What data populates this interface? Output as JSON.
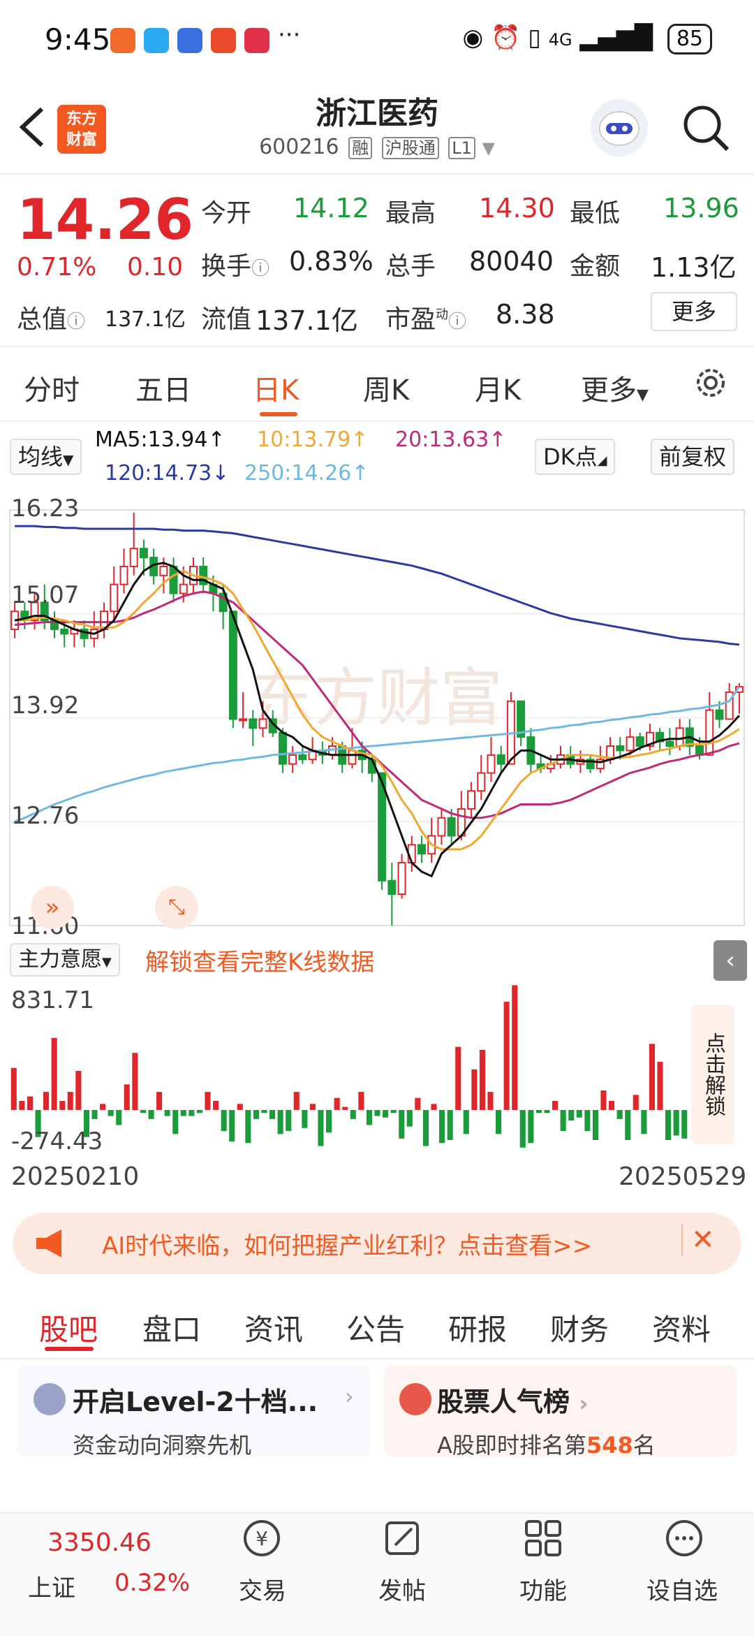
{
  "status_bar": {
    "time": "9:45",
    "network": "4G",
    "battery": "85"
  },
  "header": {
    "back_icon": "back-arrow-icon",
    "logo_text_1": "东方",
    "logo_text_2": "财富",
    "title": "浙江医药",
    "code": "600216",
    "tag_rong": "融",
    "tag_hgt": "沪股通",
    "tag_l1": "L1",
    "search_icon": "search-icon"
  },
  "quote": {
    "price": "14.26",
    "pct": "0.71%",
    "change": "0.10",
    "open_label": "今开",
    "open": "14.12",
    "high_label": "最高",
    "high": "14.30",
    "low_label": "最低",
    "low": "13.96",
    "turnover_label": "换手",
    "turnover": "0.83%",
    "volume_label": "总手",
    "volume": "80040",
    "amount_label": "金额",
    "amount": "1.13亿",
    "mktcap_label": "总值",
    "mktcap": "137.1亿",
    "float_label": "流值",
    "float": "137.1亿",
    "pe_label": "市盈",
    "pe_sup": "动",
    "pe": "8.38",
    "more": "更多"
  },
  "periods": [
    "分时",
    "五日",
    "日K",
    "周K",
    "月K",
    "更多"
  ],
  "active_period": "日K",
  "chart_controls": {
    "ma_select": "均线",
    "dk": "DK点",
    "fq": "前复权"
  },
  "ma_labels": {
    "ma5": "MA5:13.94↑",
    "ma10": "10:13.79↑",
    "ma20": "20:13.63↑",
    "ma120": "120:14.73↓",
    "ma250": "250:14.26↑"
  },
  "colors": {
    "accent": "#f25a22",
    "up": "#e0262a",
    "down": "#1a9c3a",
    "ma5": "#111111",
    "ma10": "#f0a830",
    "ma20": "#c0287a",
    "ma120": "#2a3aa0",
    "ma250": "#6fb8e0"
  },
  "chart_data": [
    {
      "type": "candlestick",
      "ylim": [
        11.6,
        16.23
      ],
      "y_ticks": [
        "16.23",
        "15.07",
        "13.92",
        "12.76",
        "11.60"
      ],
      "x_range": [
        "20250210",
        "20250529"
      ],
      "watermark": "东方财富",
      "candles": [
        [
          14.9,
          15.1,
          15.2,
          14.8
        ],
        [
          15.1,
          15.0,
          15.2,
          14.9
        ],
        [
          15.0,
          15.2,
          15.3,
          14.9
        ],
        [
          15.2,
          15.0,
          15.4,
          14.9
        ],
        [
          15.0,
          14.9,
          15.1,
          14.8
        ],
        [
          14.9,
          14.85,
          15.0,
          14.7
        ],
        [
          14.85,
          14.9,
          15.0,
          14.7
        ],
        [
          14.9,
          14.8,
          15.0,
          14.7
        ],
        [
          14.8,
          14.9,
          15.1,
          14.7
        ],
        [
          14.9,
          15.1,
          15.2,
          14.8
        ],
        [
          15.1,
          15.4,
          15.6,
          15.0
        ],
        [
          15.4,
          15.6,
          15.8,
          15.3
        ],
        [
          15.6,
          15.8,
          16.2,
          15.5
        ],
        [
          15.8,
          15.7,
          15.9,
          15.5
        ],
        [
          15.7,
          15.5,
          15.8,
          15.4
        ],
        [
          15.5,
          15.6,
          15.7,
          15.3
        ],
        [
          15.6,
          15.3,
          15.7,
          15.2
        ],
        [
          15.3,
          15.4,
          15.6,
          15.2
        ],
        [
          15.4,
          15.6,
          15.7,
          15.3
        ],
        [
          15.6,
          15.4,
          15.7,
          15.3
        ],
        [
          15.4,
          15.3,
          15.5,
          15.1
        ],
        [
          15.3,
          15.1,
          15.4,
          14.9
        ],
        [
          15.1,
          13.9,
          15.1,
          13.8
        ],
        [
          13.9,
          13.9,
          14.2,
          13.8
        ],
        [
          13.9,
          13.8,
          14.0,
          13.6
        ],
        [
          13.8,
          13.9,
          14.1,
          13.7
        ],
        [
          13.9,
          13.75,
          14.0,
          13.7
        ],
        [
          13.75,
          13.4,
          13.8,
          13.3
        ],
        [
          13.4,
          13.5,
          13.6,
          13.3
        ],
        [
          13.5,
          13.45,
          13.6,
          13.4
        ],
        [
          13.45,
          13.55,
          13.7,
          13.4
        ],
        [
          13.55,
          13.5,
          13.65,
          13.4
        ],
        [
          13.5,
          13.6,
          13.7,
          13.45
        ],
        [
          13.6,
          13.4,
          13.65,
          13.3
        ],
        [
          13.4,
          13.55,
          13.8,
          13.35
        ],
        [
          13.55,
          13.45,
          13.65,
          13.3
        ],
        [
          13.45,
          13.3,
          13.5,
          13.2
        ],
        [
          13.3,
          12.1,
          13.3,
          12.0
        ],
        [
          12.1,
          11.95,
          12.3,
          11.6
        ],
        [
          11.95,
          12.3,
          12.4,
          11.9
        ],
        [
          12.3,
          12.5,
          12.6,
          12.2
        ],
        [
          12.5,
          12.4,
          12.6,
          12.3
        ],
        [
          12.4,
          12.6,
          12.8,
          12.3
        ],
        [
          12.6,
          12.8,
          12.9,
          12.5
        ],
        [
          12.8,
          12.6,
          12.9,
          12.5
        ],
        [
          12.6,
          12.9,
          13.1,
          12.55
        ],
        [
          12.9,
          13.1,
          13.2,
          12.8
        ],
        [
          13.1,
          13.3,
          13.5,
          13.0
        ],
        [
          13.3,
          13.5,
          13.7,
          13.2
        ],
        [
          13.5,
          13.4,
          13.6,
          13.3
        ],
        [
          13.4,
          14.1,
          14.2,
          13.4
        ],
        [
          14.1,
          13.7,
          14.1,
          13.6
        ],
        [
          13.7,
          13.4,
          13.8,
          13.3
        ],
        [
          13.4,
          13.35,
          13.5,
          13.3
        ],
        [
          13.35,
          13.4,
          13.5,
          13.3
        ],
        [
          13.4,
          13.5,
          13.6,
          13.35
        ],
        [
          13.5,
          13.4,
          13.6,
          13.35
        ],
        [
          13.4,
          13.45,
          13.55,
          13.3
        ],
        [
          13.45,
          13.35,
          13.5,
          13.3
        ],
        [
          13.35,
          13.45,
          13.6,
          13.3
        ],
        [
          13.45,
          13.6,
          13.7,
          13.4
        ],
        [
          13.6,
          13.55,
          13.7,
          13.45
        ],
        [
          13.55,
          13.7,
          13.8,
          13.5
        ],
        [
          13.7,
          13.6,
          13.75,
          13.55
        ],
        [
          13.6,
          13.75,
          13.85,
          13.55
        ],
        [
          13.75,
          13.65,
          13.8,
          13.55
        ],
        [
          13.65,
          13.6,
          13.8,
          13.5
        ],
        [
          13.6,
          13.8,
          13.9,
          13.55
        ],
        [
          13.8,
          13.6,
          13.9,
          13.5
        ],
        [
          13.6,
          13.5,
          13.7,
          13.45
        ],
        [
          13.5,
          14.0,
          14.2,
          13.5
        ],
        [
          14.0,
          13.9,
          14.1,
          13.8
        ],
        [
          13.9,
          14.2,
          14.3,
          13.9
        ],
        [
          14.2,
          14.26,
          14.3,
          13.96
        ]
      ],
      "ma5": [
        15.0,
        15.02,
        15.05,
        15.05,
        15.0,
        14.95,
        14.9,
        14.87,
        14.85,
        14.9,
        15.0,
        15.2,
        15.4,
        15.55,
        15.62,
        15.64,
        15.6,
        15.5,
        15.45,
        15.45,
        15.4,
        15.35,
        15.05,
        14.75,
        14.45,
        14.0,
        13.85,
        13.75,
        13.7,
        13.6,
        13.55,
        13.52,
        13.5,
        13.5,
        13.5,
        13.5,
        13.45,
        13.2,
        12.9,
        12.6,
        12.3,
        12.2,
        12.15,
        12.4,
        12.5,
        12.6,
        12.75,
        12.9,
        13.1,
        13.3,
        13.45,
        13.55,
        13.55,
        13.5,
        13.45,
        13.45,
        13.45,
        13.43,
        13.43,
        13.42,
        13.45,
        13.48,
        13.52,
        13.58,
        13.62,
        13.66,
        13.68,
        13.68,
        13.7,
        13.65,
        13.65,
        13.72,
        13.82,
        13.94
      ],
      "ma10": [
        15.0,
        15.0,
        15.02,
        15.03,
        15.02,
        15.0,
        14.97,
        14.95,
        14.92,
        14.92,
        14.92,
        14.98,
        15.08,
        15.2,
        15.3,
        15.42,
        15.5,
        15.55,
        15.5,
        15.48,
        15.45,
        15.4,
        15.3,
        15.12,
        14.95,
        14.75,
        14.55,
        14.35,
        14.15,
        13.95,
        13.8,
        13.7,
        13.65,
        13.6,
        13.55,
        13.52,
        13.5,
        13.38,
        13.2,
        13.0,
        12.85,
        12.65,
        12.5,
        12.45,
        12.45,
        12.45,
        12.5,
        12.6,
        12.75,
        12.9,
        13.05,
        13.2,
        13.3,
        13.35,
        13.4,
        13.45,
        13.5,
        13.5,
        13.5,
        13.48,
        13.47,
        13.47,
        13.48,
        13.5,
        13.52,
        13.55,
        13.57,
        13.6,
        13.62,
        13.62,
        13.63,
        13.66,
        13.72,
        13.79
      ],
      "ma20": [
        14.95,
        14.96,
        14.97,
        14.98,
        14.98,
        14.98,
        14.98,
        14.98,
        14.98,
        14.98,
        14.98,
        15.0,
        15.03,
        15.08,
        15.12,
        15.17,
        15.22,
        15.27,
        15.3,
        15.32,
        15.3,
        15.25,
        15.2,
        15.1,
        15.0,
        14.9,
        14.8,
        14.7,
        14.6,
        14.5,
        14.35,
        14.2,
        14.05,
        13.9,
        13.75,
        13.6,
        13.5,
        13.4,
        13.3,
        13.2,
        13.1,
        13.0,
        12.95,
        12.9,
        12.85,
        12.82,
        12.8,
        12.8,
        12.82,
        12.85,
        12.9,
        12.95,
        12.95,
        12.95,
        12.95,
        12.97,
        13.0,
        13.05,
        13.1,
        13.15,
        13.2,
        13.25,
        13.3,
        13.33,
        13.36,
        13.4,
        13.43,
        13.45,
        13.48,
        13.5,
        13.52,
        13.55,
        13.6,
        13.63
      ],
      "ma120": [
        16.05,
        16.05,
        16.05,
        16.04,
        16.04,
        16.03,
        16.03,
        16.02,
        16.02,
        16.02,
        16.02,
        16.02,
        16.02,
        16.02,
        16.02,
        16.01,
        16.01,
        16.0,
        16.0,
        16.0,
        15.99,
        15.98,
        15.97,
        15.95,
        15.93,
        15.91,
        15.89,
        15.87,
        15.85,
        15.83,
        15.81,
        15.79,
        15.77,
        15.75,
        15.73,
        15.71,
        15.69,
        15.67,
        15.65,
        15.63,
        15.61,
        15.58,
        15.55,
        15.52,
        15.48,
        15.44,
        15.4,
        15.36,
        15.32,
        15.28,
        15.24,
        15.2,
        15.16,
        15.12,
        15.08,
        15.05,
        15.02,
        15.0,
        14.98,
        14.96,
        14.94,
        14.92,
        14.9,
        14.88,
        14.86,
        14.84,
        14.82,
        14.8,
        14.79,
        14.78,
        14.77,
        14.76,
        14.74,
        14.73
      ],
      "ma250": [
        12.76,
        12.8,
        12.85,
        12.9,
        12.95,
        12.99,
        13.03,
        13.07,
        13.1,
        13.14,
        13.17,
        13.2,
        13.23,
        13.26,
        13.28,
        13.31,
        13.33,
        13.35,
        13.37,
        13.39,
        13.41,
        13.42,
        13.44,
        13.45,
        13.47,
        13.48,
        13.5,
        13.51,
        13.52,
        13.53,
        13.54,
        13.55,
        13.56,
        13.57,
        13.58,
        13.59,
        13.6,
        13.61,
        13.62,
        13.63,
        13.64,
        13.65,
        13.66,
        13.67,
        13.68,
        13.69,
        13.7,
        13.71,
        13.72,
        13.73,
        13.74,
        13.75,
        13.77,
        13.78,
        13.8,
        13.81,
        13.83,
        13.84,
        13.86,
        13.87,
        13.89,
        13.9,
        13.92,
        13.93,
        13.95,
        13.96,
        13.98,
        13.99,
        14.01,
        14.02,
        14.04,
        14.06,
        14.1,
        14.26
      ]
    },
    {
      "type": "bar",
      "title": "主力意愿",
      "ylim": [
        -274.43,
        831.71
      ],
      "y_ticks": [
        "831.71",
        "-274.43"
      ],
      "values": [
        280,
        60,
        90,
        -180,
        120,
        480,
        60,
        120,
        260,
        -180,
        -60,
        40,
        -40,
        -100,
        170,
        380,
        -20,
        -60,
        120,
        -40,
        -160,
        -40,
        -40,
        -20,
        120,
        60,
        -140,
        -210,
        40,
        -220,
        -60,
        -20,
        -60,
        -160,
        -140,
        120,
        -120,
        40,
        -240,
        -150,
        80,
        20,
        -60,
        120,
        -100,
        -40,
        -50,
        -20,
        -190,
        -110,
        80,
        -240,
        40,
        -220,
        -200,
        420,
        -160,
        270,
        400,
        120,
        -160,
        720,
        830,
        -250,
        -220,
        -20,
        -20,
        60,
        -140,
        -70,
        -50,
        -140,
        -200,
        130,
        60,
        -60,
        -200,
        100,
        -160,
        440,
        320,
        -200,
        -170,
        -190
      ],
      "unlock_text": "解锁查看完整K线数据"
    }
  ],
  "side_unlock": "点击解锁",
  "banner": {
    "text": "AI时代来临，如何把握产业红利？点击查看>>",
    "megaphone_icon": "megaphone-icon",
    "close_icon": "close-icon"
  },
  "tabs2": [
    "股吧",
    "盘口",
    "资讯",
    "公告",
    "研报",
    "财务",
    "资料"
  ],
  "cards": [
    {
      "title": "开启Level-2十档...",
      "sub": "资金动向洞察先机"
    },
    {
      "title": "股票人气榜",
      "sub_pre": "A股即时排名第",
      "rank": "548",
      "sub_post": "名"
    }
  ],
  "bottom_nav": {
    "index_value": "3350.46",
    "index_name": "上证",
    "index_pct": "0.32%",
    "items": [
      "交易",
      "发帖",
      "功能",
      "设自选"
    ]
  }
}
